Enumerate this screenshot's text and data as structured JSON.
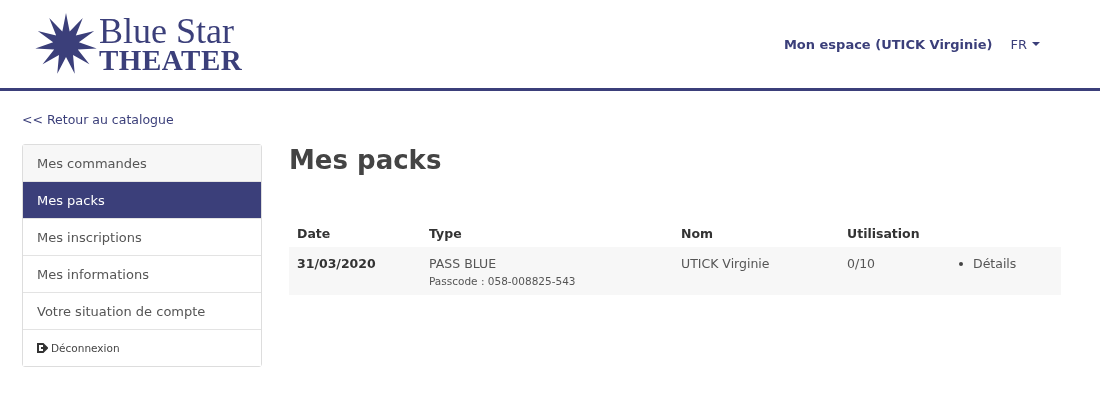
{
  "logo": {
    "line_1": "Blue Star",
    "line_2": "THEATER"
  },
  "header": {
    "account_link": "Mon espace (UTICK Virginie)",
    "language": "FR"
  },
  "back_link": "<< Retour au catalogue",
  "sidebar": {
    "items": [
      {
        "label": "Mes commandes",
        "selected": false,
        "kind": "link"
      },
      {
        "label": "Mes packs",
        "selected": true,
        "kind": "link"
      },
      {
        "label": "Mes inscriptions",
        "selected": false,
        "kind": "link"
      },
      {
        "label": "Mes informations",
        "selected": false,
        "kind": "link"
      },
      {
        "label": "Votre situation de compte",
        "selected": false,
        "kind": "link"
      },
      {
        "label": "Déconnexion",
        "selected": false,
        "kind": "logout"
      }
    ]
  },
  "page_title": "Mes packs",
  "table": {
    "columns": [
      "Date",
      "Type",
      "Nom",
      "Utilisation"
    ],
    "rows": [
      {
        "date": "31/03/2020",
        "type": "PASS BLUE",
        "passcode": "Passcode : 058-008825-543",
        "nom": "UTICK Virginie",
        "utilisation": "0/10",
        "action": "Détails"
      }
    ]
  }
}
